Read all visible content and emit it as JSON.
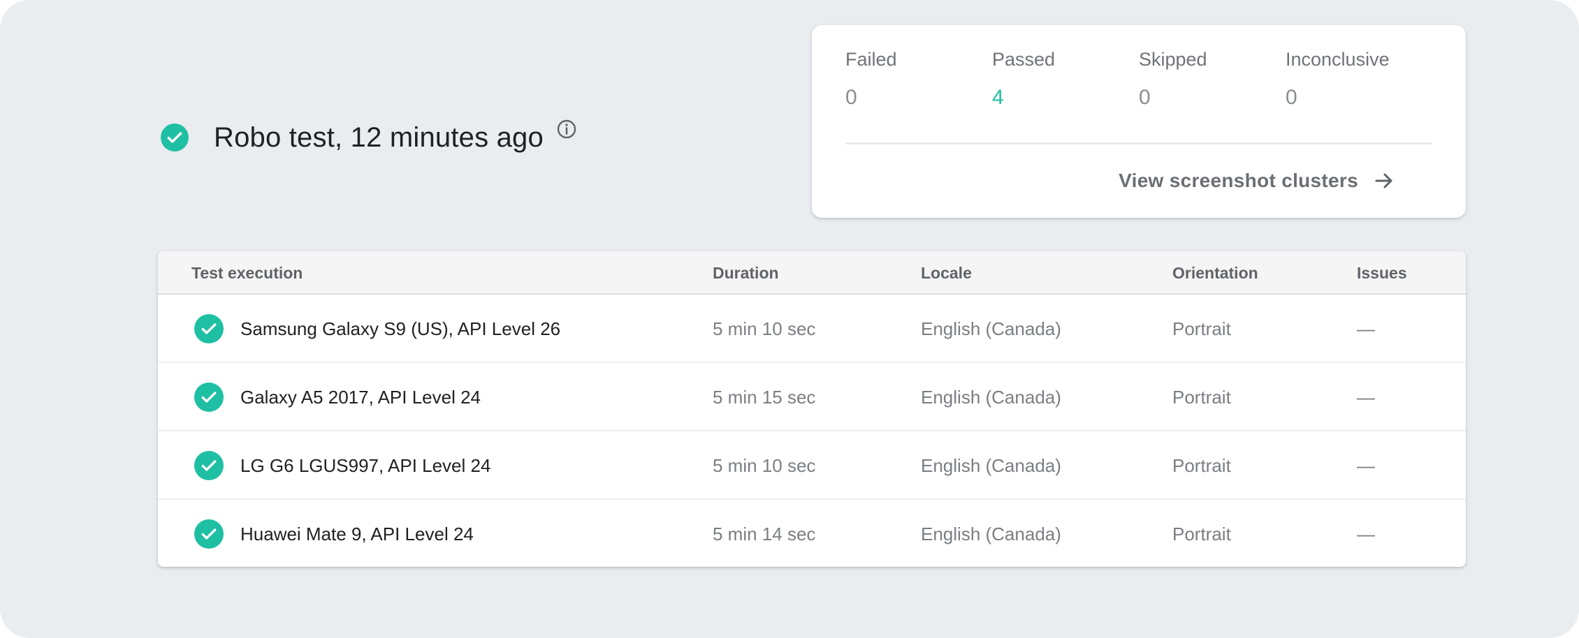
{
  "header": {
    "title": "Robo test, 12 minutes ago",
    "status_icon": "check-circle-icon",
    "info_icon": "info-icon"
  },
  "stats": {
    "items": [
      {
        "label": "Failed",
        "value": "0"
      },
      {
        "label": "Passed",
        "value": "4"
      },
      {
        "label": "Skipped",
        "value": "0"
      },
      {
        "label": "Inconclusive",
        "value": "0"
      }
    ],
    "link_label": "View screenshot clusters",
    "link_icon": "arrow-right-icon"
  },
  "table": {
    "columns": [
      "Test execution",
      "Duration",
      "Locale",
      "Orientation",
      "Issues"
    ],
    "rows": [
      {
        "device": "Samsung Galaxy S9 (US), API Level 26",
        "duration": "5 min 10 sec",
        "locale": "English (Canada)",
        "orientation": "Portrait",
        "issues": "—"
      },
      {
        "device": "Galaxy A5 2017, API Level 24",
        "duration": "5 min 15 sec",
        "locale": "English (Canada)",
        "orientation": "Portrait",
        "issues": "—"
      },
      {
        "device": "LG G6 LGUS997, API Level 24",
        "duration": "5 min 10 sec",
        "locale": "English (Canada)",
        "orientation": "Portrait",
        "issues": "—"
      },
      {
        "device": "Huawei Mate 9, API Level 24",
        "duration": "5 min 14 sec",
        "locale": "English (Canada)",
        "orientation": "Portrait",
        "issues": "—"
      }
    ]
  },
  "colors": {
    "success": "#1fbfa3",
    "background": "#eaedf0",
    "text_primary": "#202124",
    "text_secondary": "#7a7e83"
  }
}
